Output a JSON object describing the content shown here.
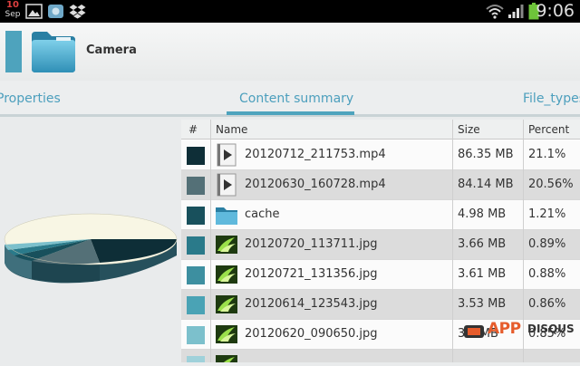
{
  "status_bar": {
    "day": "10",
    "month": "Sep",
    "time": "9:06",
    "icons": [
      "picture-icon",
      "app-icon",
      "dropbox-icon",
      "wifi-icon",
      "signal-icon",
      "battery-icon"
    ]
  },
  "action_bar": {
    "title": "Camera",
    "folder_icon": "folder-icon"
  },
  "tabs": [
    {
      "label": "Properties"
    },
    {
      "label": "Content summary",
      "selected": true
    },
    {
      "label": "File_types"
    }
  ],
  "table": {
    "columns": [
      "#",
      "Name",
      "Size",
      "Percent"
    ],
    "rows": [
      {
        "color": "#0e2e37",
        "icon": "video-icon",
        "name": "20120712_211753.mp4",
        "size": "86.35 MB",
        "percent": "21.1%"
      },
      {
        "color": "#547077",
        "icon": "video-icon",
        "name": "20120630_160728.mp4",
        "size": "84.14 MB",
        "percent": "20.56%"
      },
      {
        "color": "#18505c",
        "icon": "folder-icon",
        "name": "cache",
        "size": "4.98 MB",
        "percent": "1.21%"
      },
      {
        "color": "#2a7a8a",
        "icon": "image-icon",
        "name": "20120720_113711.jpg",
        "size": "3.66 MB",
        "percent": "0.89%"
      },
      {
        "color": "#3d8fa0",
        "icon": "image-icon",
        "name": "20120721_131356.jpg",
        "size": "3.61 MB",
        "percent": "0.88%"
      },
      {
        "color": "#4aa3b5",
        "icon": "image-icon",
        "name": "20120614_123543.jpg",
        "size": "3.53 MB",
        "percent": "0.86%"
      },
      {
        "color": "#7cc0cc",
        "icon": "image-icon",
        "name": "20120620_090650.jpg",
        "size": "3.5 MB",
        "percent": "0.85%"
      },
      {
        "color": "#9fd1da",
        "icon": "image-icon",
        "name": "",
        "size": "",
        "percent": ""
      }
    ]
  },
  "pie": {
    "colors": [
      "#f8f6e4",
      "#0e2e37",
      "#547077",
      "#18505c",
      "#2a7a8a",
      "#7cc0cc"
    ]
  },
  "watermark": {
    "text": "APP",
    "text2": "DISQUS"
  }
}
